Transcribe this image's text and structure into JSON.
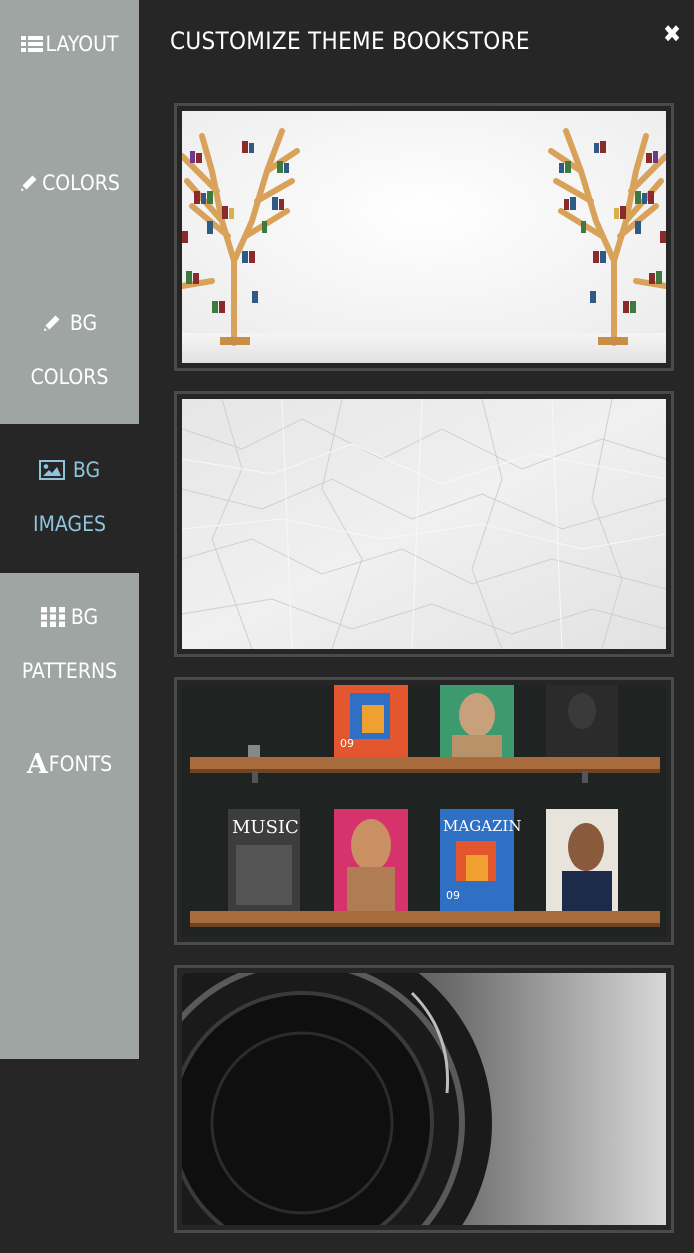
{
  "sidebar": {
    "items": [
      {
        "label": "LAYOUT",
        "icon": "list-icon",
        "active": false
      },
      {
        "label": "COLORS",
        "icon": "pencil-icon",
        "active": false
      },
      {
        "label_line1": "BG",
        "label_line2": "COLORS",
        "icon": "pencil-icon",
        "active": false
      },
      {
        "label_line1": "BG",
        "label_line2": "IMAGES",
        "icon": "image-icon",
        "active": true
      },
      {
        "label_line1": "BG",
        "label_line2": "PATTERNS",
        "icon": "grid-icon",
        "active": false
      },
      {
        "label": "FONTS",
        "icon": "font-icon",
        "icon_glyph": "A",
        "active": false
      }
    ]
  },
  "panel": {
    "title": "CUSTOMIZE THEME BOOKSTORE",
    "close_glyph": "✖"
  },
  "thumbnails": [
    {
      "name": "bookshelf-trees"
    },
    {
      "name": "crumpled-paper"
    },
    {
      "name": "magazine-shelves",
      "magazine_labels": [
        "MUSIC",
        "MAGAZIN"
      ],
      "magazine_numbers": [
        "09",
        "09"
      ]
    },
    {
      "name": "camera-lens"
    }
  ],
  "colors": {
    "sidebar_bg": "#9ea5a2",
    "panel_bg": "#262626",
    "active_text": "#8fc4da",
    "thumb_border": "#4a4a4a"
  }
}
